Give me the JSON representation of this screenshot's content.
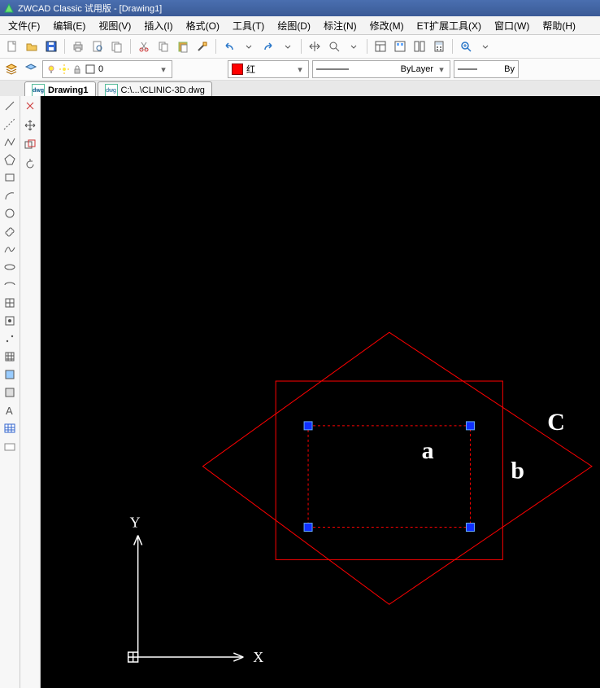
{
  "title": "ZWCAD Classic 试用版 - [Drawing1]",
  "menu": [
    "文件(F)",
    "编辑(E)",
    "视图(V)",
    "插入(I)",
    "格式(O)",
    "工具(T)",
    "绘图(D)",
    "标注(N)",
    "修改(M)",
    "ET扩展工具(X)",
    "窗口(W)",
    "帮助(H)"
  ],
  "layer_value": "0",
  "color_value": "红",
  "linetype_value": "ByLayer",
  "lineweight_value": "By",
  "tabs": {
    "active": "Drawing1",
    "inactive": "C:\\...\\CLINIC-3D.dwg"
  },
  "canvas": {
    "axis_x": "X",
    "axis_y": "Y",
    "label_a": "a",
    "label_b": "b",
    "label_c": "C"
  }
}
